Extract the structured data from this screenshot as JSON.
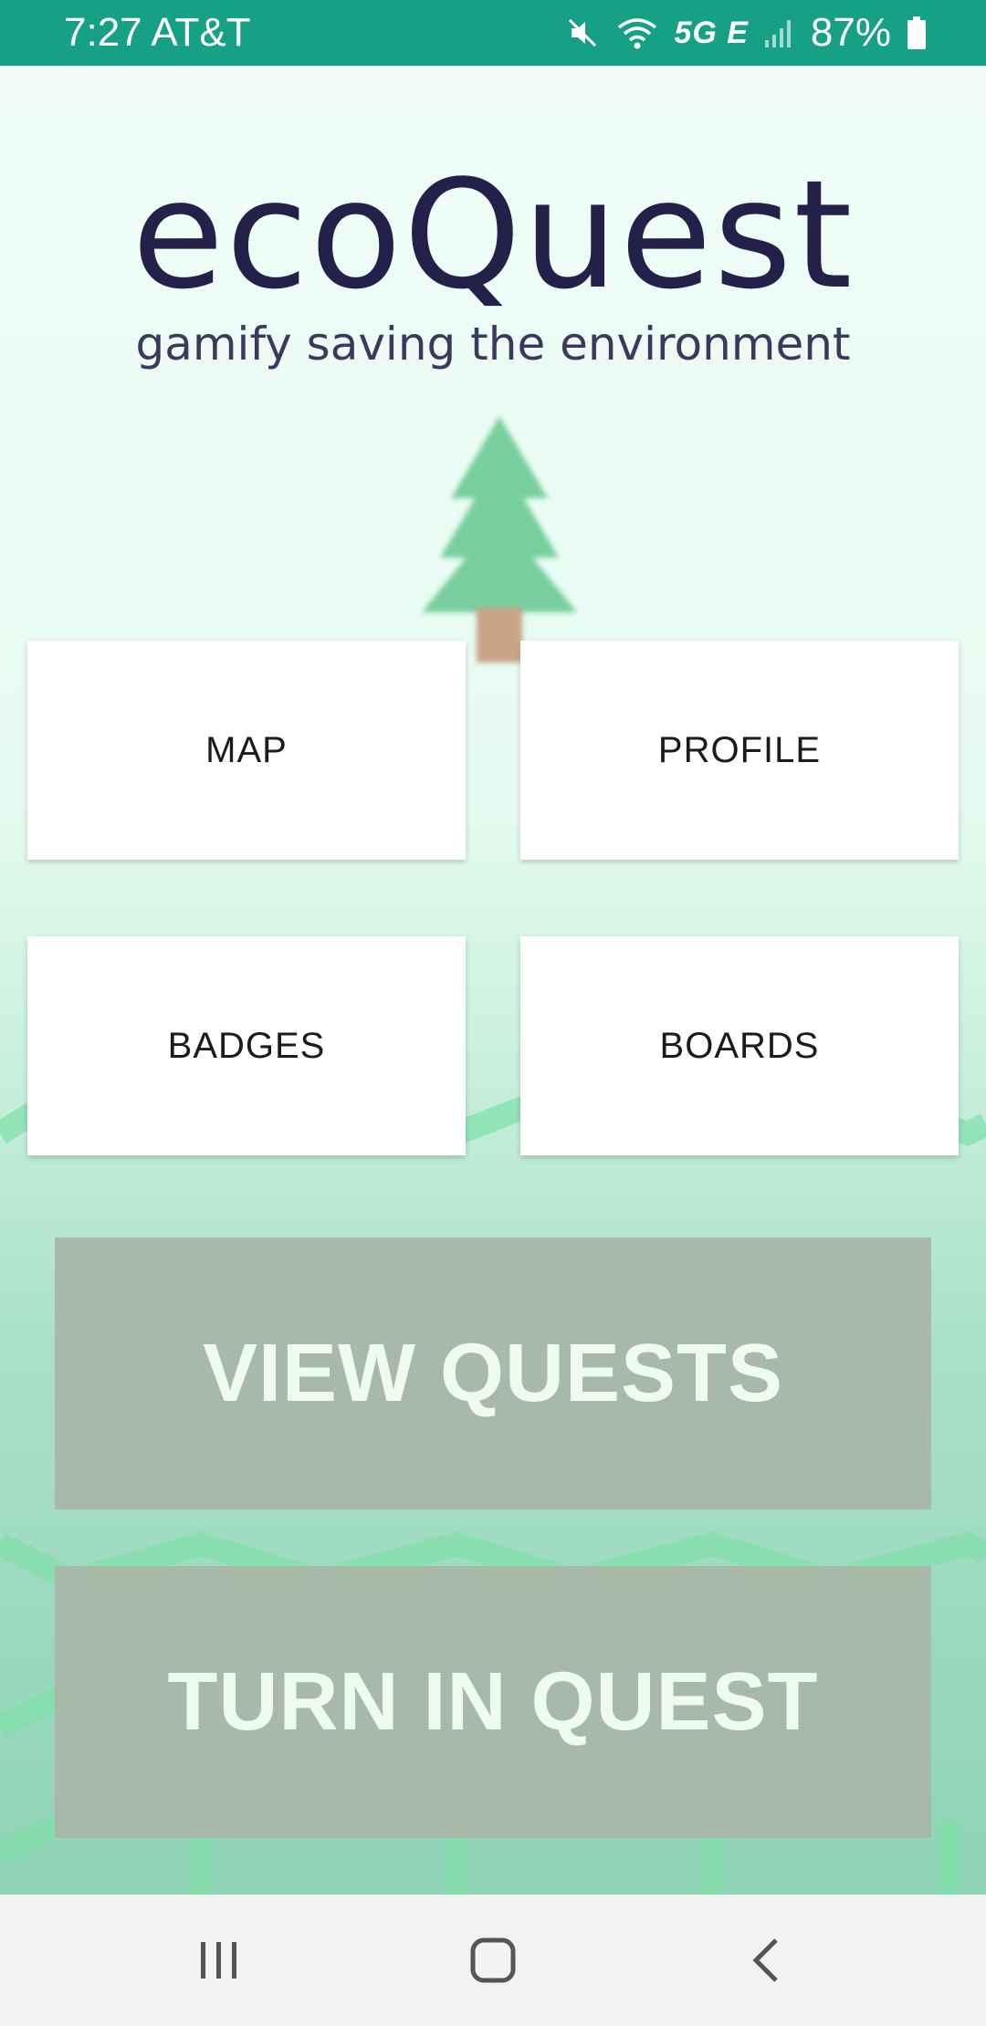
{
  "status_bar": {
    "time_carrier": "7:27 AT&T",
    "network": "5G E",
    "battery": "87%",
    "icons": [
      "mute-icon",
      "wifi-icon",
      "signal-icon",
      "battery-icon"
    ]
  },
  "header": {
    "title": "ecoQuest",
    "subtitle": "gamify saving the environment"
  },
  "menu": {
    "map_label": "MAP",
    "profile_label": "PROFILE",
    "badges_label": "BADGES",
    "boards_label": "BOARDS"
  },
  "actions": {
    "view_quests_label": "VIEW QUESTS",
    "turn_in_label": "TURN IN QUEST"
  },
  "navigation": {
    "icons": [
      "recent-apps-icon",
      "home-icon",
      "back-icon"
    ]
  },
  "colors": {
    "status_bar": "#16a085",
    "title": "#23214a",
    "action_button": "#a8baa7",
    "action_text": "#eefcef",
    "tree_foliage": "#77cf9d",
    "tree_trunk": "#c9a386"
  }
}
